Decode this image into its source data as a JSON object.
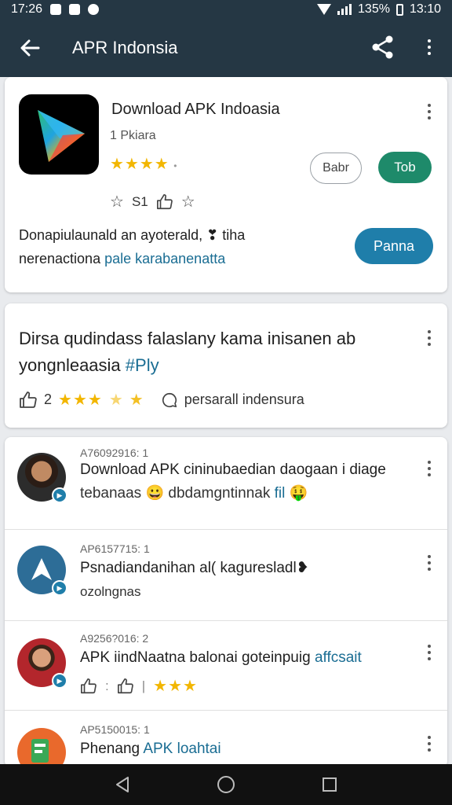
{
  "status_bar": {
    "time": "17:26",
    "battery_pct": "135%",
    "clock": "13:10"
  },
  "app_bar": {
    "title": "APR Indonsia",
    "back_icon": "arrow-left-icon",
    "share_icon": "share-icon"
  },
  "app_card": {
    "name": "Download APK Indoasia",
    "subtitle": "1 Pkiara",
    "stars": "★★★★",
    "stars_extra": "•",
    "btn_secondary": "Babr",
    "btn_primary": "Tob",
    "action_count": "S1",
    "description_line1": "Donapiulaunald an ayoterald, ❣ tiha",
    "description_line2a": "nerenactiona",
    "description_line2b": " pale karabanenatta",
    "btn_open": "Panna"
  },
  "post_card": {
    "text_line1": "Dirsa qudindass falaslany kama inisanen ab",
    "text_line2a": "yongnleaasia",
    "text_line2b": " #Ply",
    "likes": "2",
    "stars": "★★★",
    "star_half": "★",
    "star_outline": "★",
    "comment_label": "persarall indensura"
  },
  "comments": [
    {
      "meta": "A76092916: 1",
      "line1": "Download APK cininubaedian daogaan i diage",
      "line2a": "tebanaas 😀 dbdamgntinnak ",
      "line2b": "fil",
      "line2c": " 🤑"
    },
    {
      "meta": "AP6157715: 1",
      "line1": "Psnadiandanihan al( kaguresladl❥",
      "line2a": "ozolngnas",
      "line2b": "",
      "line2c": ""
    },
    {
      "meta": "A9256?016: 2",
      "line1a": "APK iindNaatna balonai goteinpuig ",
      "line1b": "affcsait",
      "stars": "★★★"
    },
    {
      "meta": "AP5150015: 1",
      "line1a": "Phenang ",
      "line1b": "APK loahtai"
    }
  ],
  "colors": {
    "app_bar": "#253744",
    "accent_green": "#1e8a6a",
    "accent_blue": "#1f7eaa",
    "star": "#f2b600"
  }
}
